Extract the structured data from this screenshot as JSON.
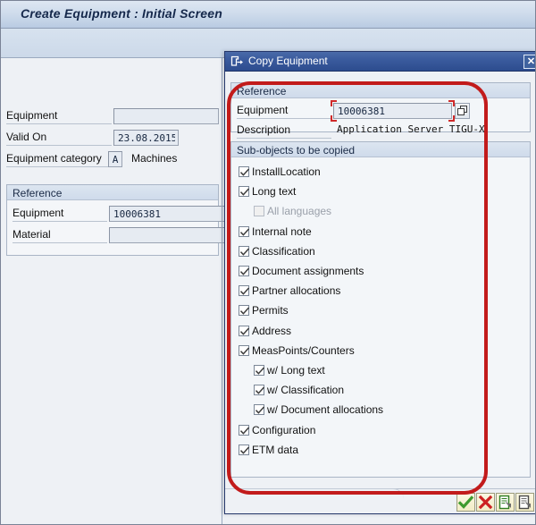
{
  "window": {
    "title": "Create Equipment : Initial Screen"
  },
  "main_form": {
    "fields": [
      {
        "label": "Equipment",
        "value": ""
      },
      {
        "label": "Valid On",
        "value": "23.08.2015"
      },
      {
        "label": "Equipment category",
        "value": "A",
        "suffix": "Machines"
      }
    ],
    "reference_group": {
      "title": "Reference",
      "fields": [
        {
          "label": "Equipment",
          "value": "10006381"
        },
        {
          "label": "Material",
          "value": ""
        }
      ]
    }
  },
  "dialog": {
    "title": "Copy Equipment",
    "title_icon": "copy-export-icon",
    "close_label": "✕",
    "reference_group": {
      "title": "Reference",
      "equipment_label": "Equipment",
      "equipment_value": "10006381",
      "matchcode_icon": "matchcode-overlapping-squares-icon",
      "description_label": "Description",
      "description_value": "Application Server TIGU-X"
    },
    "subobjects_group": {
      "title": "Sub-objects to be copied",
      "items": [
        {
          "label": "InstallLocation",
          "checked": true,
          "indent": 0,
          "disabled": false
        },
        {
          "label": "Long text",
          "checked": true,
          "indent": 0,
          "disabled": false
        },
        {
          "label": "All languages",
          "checked": false,
          "indent": 1,
          "disabled": true
        },
        {
          "label": "Internal note",
          "checked": true,
          "indent": 0,
          "disabled": false
        },
        {
          "label": "Classification",
          "checked": true,
          "indent": 0,
          "disabled": false
        },
        {
          "label": "Document assignments",
          "checked": true,
          "indent": 0,
          "disabled": false
        },
        {
          "label": "Partner allocations",
          "checked": true,
          "indent": 0,
          "disabled": false
        },
        {
          "label": "Permits",
          "checked": true,
          "indent": 0,
          "disabled": false
        },
        {
          "label": "Address",
          "checked": true,
          "indent": 0,
          "disabled": false
        },
        {
          "label": "MeasPoints/Counters",
          "checked": true,
          "indent": 0,
          "disabled": false
        },
        {
          "label": "w/ Long text",
          "checked": true,
          "indent": 1,
          "disabled": false
        },
        {
          "label": "w/ Classification",
          "checked": true,
          "indent": 1,
          "disabled": false
        },
        {
          "label": "w/ Document allocations",
          "checked": true,
          "indent": 1,
          "disabled": false
        },
        {
          "label": "Configuration",
          "checked": true,
          "indent": 0,
          "disabled": false
        },
        {
          "label": "ETM data",
          "checked": true,
          "indent": 0,
          "disabled": false
        }
      ]
    },
    "footer_buttons": [
      {
        "name": "continue-button",
        "icon": "green-check-icon"
      },
      {
        "name": "cancel-button",
        "icon": "red-cross-icon"
      },
      {
        "name": "copy-with-detail-button",
        "icon": "document-green-arrow-icon"
      },
      {
        "name": "copy-plain-button",
        "icon": "document-grey-arrow-icon"
      }
    ]
  },
  "annotation": {
    "shape": "red-rounded-rectangle-highlight",
    "color": "#c21b1b"
  }
}
